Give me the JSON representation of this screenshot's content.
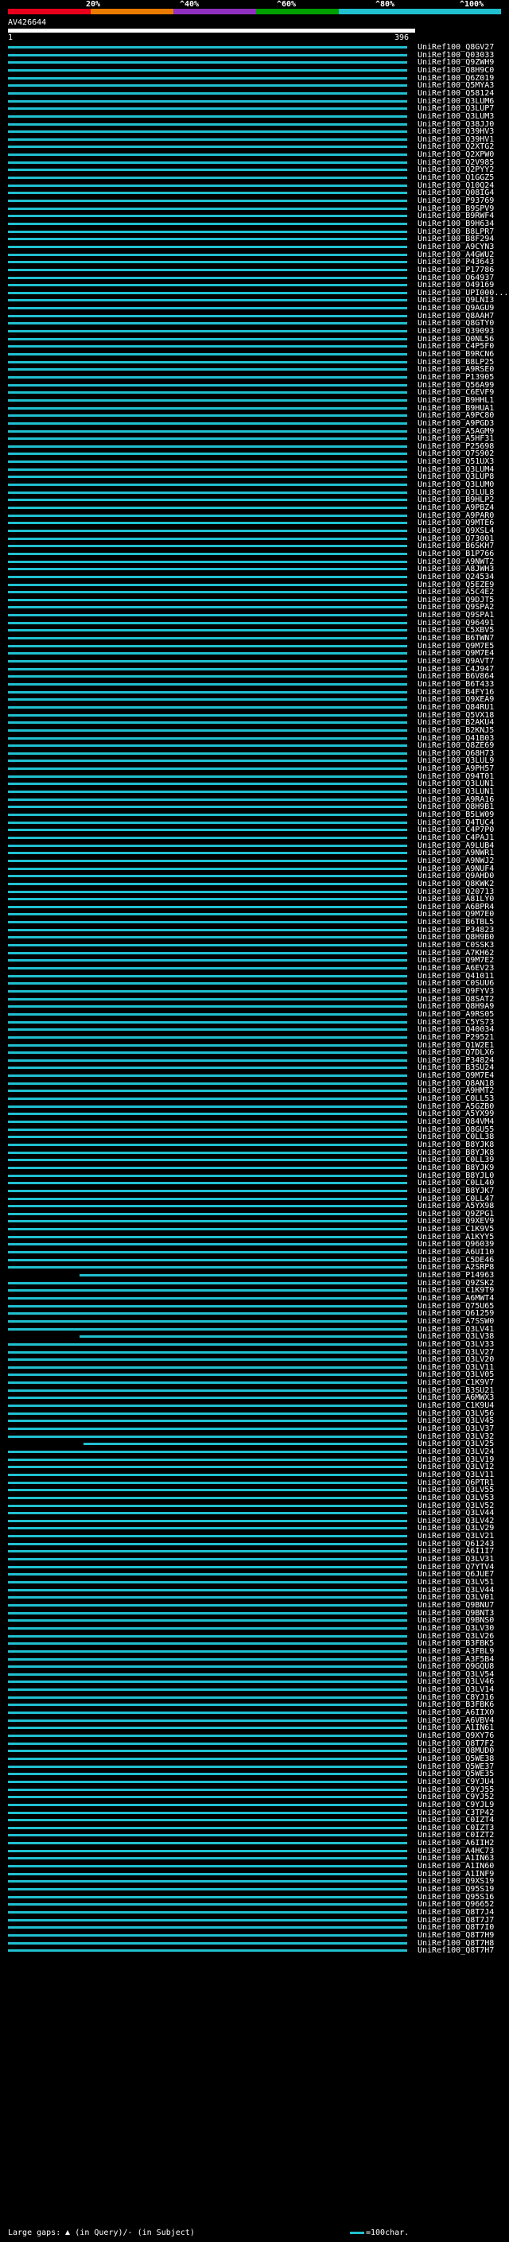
{
  "scale": {
    "colors": [
      "#e8001c",
      "#e87a00",
      "#9030c0",
      "#00a000",
      "#20c0d0"
    ],
    "marks": [
      "20%",
      "^40%",
      "^60%",
      "^80%",
      "^100%"
    ]
  },
  "query": {
    "name": "AV426644",
    "start": "1",
    "end": "396"
  },
  "hit_color": "#20c0d0",
  "hits": [
    "UniRef100_Q8GV27",
    "UniRef100_Q03033",
    "UniRef100_Q9ZWH9",
    "UniRef100_Q8H9C0",
    "UniRef100_Q6Z019",
    "UniRef100_Q5MYA3",
    "UniRef100_Q58124",
    "UniRef100_Q3LUM6",
    "UniRef100_Q3LUP7",
    "UniRef100_Q3LUM3",
    "UniRef100_Q38JJ0",
    "UniRef100_Q39HV3",
    "UniRef100_Q39HV1",
    "UniRef100_Q2XTG2",
    "UniRef100_Q2XPW0",
    "UniRef100_Q2V985",
    "UniRef100_Q2PYY2",
    "UniRef100_Q1GGZ5",
    "UniRef100_Q10Q24",
    "UniRef100_Q08IG4",
    "UniRef100_P93769",
    "UniRef100_B9SPV9",
    "UniRef100_B9RWF4",
    "UniRef100_B9H634",
    "UniRef100_B8LPR7",
    "UniRef100_B8F294",
    "UniRef100_A9CYN3",
    "UniRef100_A4GWU2",
    "UniRef100_P43643",
    "UniRef100_P17786",
    "UniRef100_O64937",
    "UniRef100_O49169",
    "UniRef100_UPI000...",
    "UniRef100_Q9LNI3",
    "UniRef100_Q9AGU9",
    "UniRef100_Q8AAH7",
    "UniRef100_Q8GTY0",
    "UniRef100_Q39093",
    "UniRef100_Q0NL56",
    "UniRef100_C4P5F0",
    "UniRef100_B9RCN6",
    "UniRef100_B8LP25",
    "UniRef100_A9RSE0",
    "UniRef100_P13905",
    "UniRef100_Q56A99",
    "UniRef100_C6EVF9",
    "UniRef100_B9HHL1",
    "UniRef100_B9HUA1",
    "UniRef100_A9PC80",
    "UniRef100_A9PGD3",
    "UniRef100_A5AGM9",
    "UniRef100_A5HF31",
    "UniRef100_P25698",
    "UniRef100_Q7S902",
    "UniRef100_Q51UX3",
    "UniRef100_Q3LUM4",
    "UniRef100_Q3LUP8",
    "UniRef100_Q3LUM0",
    "UniRef100_Q3LUL8",
    "UniRef100_B9HLP2",
    "UniRef100_A9PBZ4",
    "UniRef100_A9PAR0",
    "UniRef100_Q9MTE6",
    "UniRef100_Q9XSL4",
    "UniRef100_Q73001",
    "UniRef100_B6SKH7",
    "UniRef100_B1P766",
    "UniRef100_A9NWT2",
    "UniRef100_A8JWH3",
    "UniRef100_Q24534",
    "UniRef100_Q5EZE9",
    "UniRef100_A5C4E2",
    "UniRef100_Q9DJT5",
    "UniRef100_Q9SPA2",
    "UniRef100_Q9SPA1",
    "UniRef100_Q96491",
    "UniRef100_C5XBV5",
    "UniRef100_B6TWN7",
    "UniRef100_Q9M7E5",
    "UniRef100_Q9M7E4",
    "UniRef100_Q9AVT7",
    "UniRef100_C4J947",
    "UniRef100_B6V864",
    "UniRef100_B6T433",
    "UniRef100_B4FY16",
    "UniRef100_Q9XEA9",
    "UniRef100_Q84RU1",
    "UniRef100_Q5VX18",
    "UniRef100_B2AKU4",
    "UniRef100_B2KNJ5",
    "UniRef100_Q41B03",
    "UniRef100_Q8ZE69",
    "UniRef100_Q68H73",
    "UniRef100_Q3LUL9",
    "UniRef100_A9PH57",
    "UniRef100_Q94T01",
    "UniRef100_Q3LUN1",
    "UniRef100_Q3LUN1",
    "UniRef100_A9RA16",
    "UniRef100_Q8H9B1",
    "UniRef100_B5LW09",
    "UniRef100_Q4TUC4",
    "UniRef100_C4P7P0",
    "UniRef100_C4PAJ1",
    "UniRef100_A9LUB4",
    "UniRef100_A9NWR1",
    "UniRef100_A9NWJ2",
    "UniRef100_A9NUF4",
    "UniRef100_Q9AHD0",
    "UniRef100_Q8KWK2",
    "UniRef100_Q20713",
    "UniRef100_A81LY0",
    "UniRef100_A6BPR4",
    "UniRef100_Q9M7E0",
    "UniRef100_B6TBL5",
    "UniRef100_P34823",
    "UniRef100_Q8H9B0",
    "UniRef100_C0SSK3",
    "UniRef100_A7KH62",
    "UniRef100_Q9M7E2",
    "UniRef100_A6EV23",
    "UniRef100_Q41011",
    "UniRef100_C0SUU6",
    "UniRef100_Q9FYV3",
    "UniRef100_Q8SAT2",
    "UniRef100_Q8H9A9",
    "UniRef100_A9RS05",
    "UniRef100_C5YS73",
    "UniRef100_Q40034",
    "UniRef100_P29521",
    "UniRef100_Q1W2E1",
    "UniRef100_Q7DLX6",
    "UniRef100_P34824",
    "UniRef100_B3SU24",
    "UniRef100_Q9M7E4",
    "UniRef100_Q8AN18",
    "UniRef100_A9HMT2",
    "UniRef100_C0LL53",
    "UniRef100_A5GZB0",
    "UniRef100_A5YX99",
    "UniRef100_Q84VM4",
    "UniRef100_Q8GU55",
    "UniRef100_C0LL38",
    "UniRef100_B8YJK8",
    "UniRef100_B8YJK8",
    "UniRef100_C0LL39",
    "UniRef100_B8YJK9",
    "UniRef100_B8YJL0",
    "UniRef100_C0LL40",
    "UniRef100_B8YJK7",
    "UniRef100_C0LL47",
    "UniRef100_A5YX98",
    "UniRef100_Q9ZPG1",
    "UniRef100_Q9XEV9",
    "UniRef100_C1K9V5",
    "UniRef100_A1KYY5",
    "UniRef100_Q96039",
    "UniRef100_A6UI10",
    "UniRef100_C5DE46",
    "UniRef100_A2SRP8",
    "UniRef100_P14963",
    "UniRef100_Q9ZSK2",
    "UniRef100_C1K9T9",
    "UniRef100_A6MWT4",
    "UniRef100_Q75U65",
    "UniRef100_Q61259",
    "UniRef100_A7SSW0",
    "UniRef100_Q3LV41",
    "UniRef100_Q3LV38",
    "UniRef100_Q3LV33",
    "UniRef100_Q3LV27",
    "UniRef100_Q3LV20",
    "UniRef100_Q3LV11",
    "UniRef100_Q3LV05",
    "UniRef100_C1K9V7",
    "UniRef100_B3SU21",
    "UniRef100_A6MWX3",
    "UniRef100_C1K9U4",
    "UniRef100_Q3LV56",
    "UniRef100_Q3LV45",
    "UniRef100_Q3LV37",
    "UniRef100_Q3LV32",
    "UniRef100_Q3LV25",
    "UniRef100_Q3LV24",
    "UniRef100_Q3LV19",
    "UniRef100_Q3LV12",
    "UniRef100_Q3LV11",
    "UniRef100_Q6PTR1",
    "UniRef100_Q3LV55",
    "UniRef100_Q3LV53",
    "UniRef100_Q3LV52",
    "UniRef100_Q3LV44",
    "UniRef100_Q3LV42",
    "UniRef100_Q3LV29",
    "UniRef100_Q3LV21",
    "UniRef100_Q61243",
    "UniRef100_A6I1I7",
    "UniRef100_Q3LV31",
    "UniRef100_Q7YTV4",
    "UniRef100_Q6JUE7",
    "UniRef100_Q3LV51",
    "UniRef100_Q3LV44",
    "UniRef100_Q3LV01",
    "UniRef100_Q9BNU7",
    "UniRef100_Q9BNT3",
    "UniRef100_Q9BNS0",
    "UniRef100_Q3LV30",
    "UniRef100_Q3LV26",
    "UniRef100_B3FBK5",
    "UniRef100_A3FBL9",
    "UniRef100_A3F5B4",
    "UniRef100_Q9GQU8",
    "UniRef100_Q3LV54",
    "UniRef100_Q3LV46",
    "UniRef100_Q3LV14",
    "UniRef100_C8YJ16",
    "UniRef100_B3FBK6",
    "UniRef100_A6IIX0",
    "UniRef100_A6VBV4",
    "UniRef100_A1IN61",
    "UniRef100_Q9XY76",
    "UniRef100_Q8T7F2",
    "UniRef100_Q8MUD0",
    "UniRef100_Q5WE38",
    "UniRef100_Q5WE37",
    "UniRef100_Q5WE35",
    "UniRef100_C9YJU4",
    "UniRef100_C9YJ55",
    "UniRef100_C9YJ52",
    "UniRef100_C9YJL9",
    "UniRef100_C3TP42",
    "UniRef100_C0IZT4",
    "UniRef100_C0IZT3",
    "UniRef100_C0IZT2",
    "UniRef100_A6IIH2",
    "UniRef100_A4HC73",
    "UniRef100_A1IN63",
    "UniRef100_A1IN60",
    "UniRef100_A1INF9",
    "UniRef100_Q9XS19",
    "UniRef100_Q95S19",
    "UniRef100_Q95S16",
    "UniRef100_Q96652",
    "UniRef100_Q8T7J4",
    "UniRef100_Q8T7J7",
    "UniRef100_Q8T7I0",
    "UniRef100_Q8T7H9",
    "UniRef100_Q8T7H8",
    "UniRef100_Q8T7H7"
  ],
  "gapped_rows": [
    160,
    168,
    182
  ],
  "legend": {
    "large_gaps": "Large gaps:",
    "in_query": "(in Query)",
    "separator": "/-",
    "in_subject": "(in Subject)",
    "scale_label": "=100char."
  }
}
